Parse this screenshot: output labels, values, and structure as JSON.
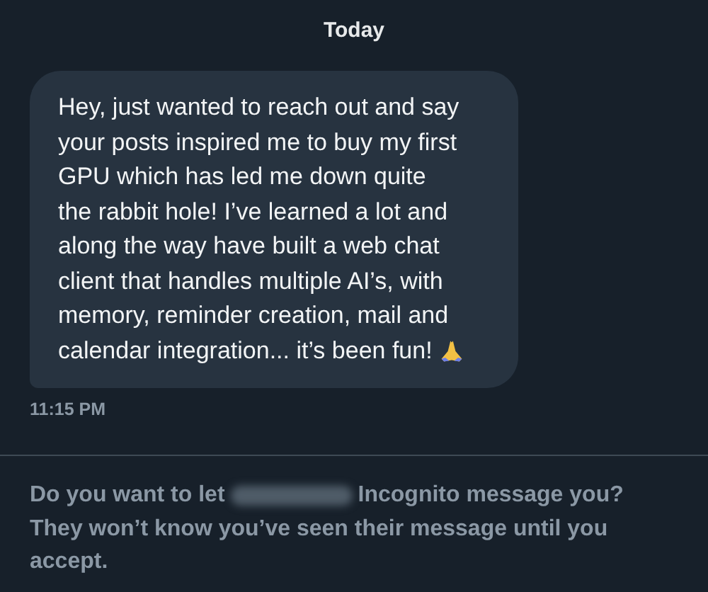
{
  "date_header": "Today",
  "message": {
    "lines": [
      "Hey, just wanted to reach out and say",
      "your posts inspired me to buy my first",
      "GPU which has led me down quite",
      "the rabbit hole! I’ve learned a lot and",
      "along the way have built a web chat",
      "client that handles multiple AI’s, with",
      "memory, reminder creation, mail and",
      "calendar integration... it’s been fun!"
    ],
    "time": "11:15 PM"
  },
  "request": {
    "prompt_before": "Do you want to let",
    "prompt_after": "Incognito message you?",
    "prompt_rest": "They won’t know you’ve seen their message until you accept."
  }
}
